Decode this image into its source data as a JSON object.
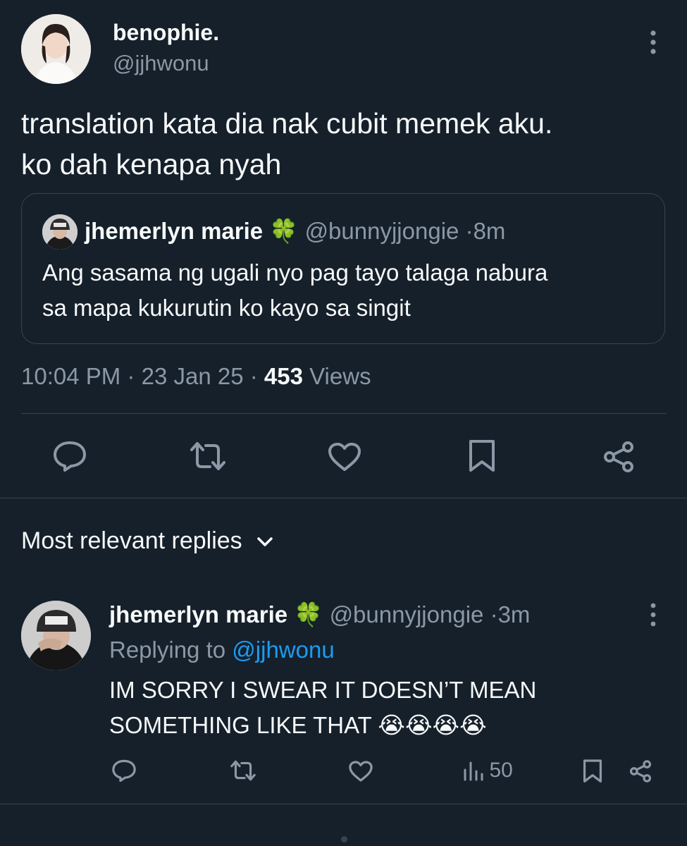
{
  "post": {
    "author_name": "benophie.",
    "author_handle": "@jjhwonu",
    "text_line1": "translation kata dia nak cubit memek aku.",
    "text_line2": "ko dah kenapa nyah",
    "quote": {
      "author_name": "jhemerlyn marie",
      "author_emoji": "🍀",
      "author_handle": "@bunnyjjongie",
      "sep": "·",
      "time": "8m",
      "text_line1": "Ang sasama ng ugali nyo pag tayo talaga nabura",
      "text_line2": "sa mapa kukurutin ko kayo sa singit"
    },
    "time": "10:04 PM",
    "sep1": "·",
    "date": "23 Jan 25",
    "sep2": "·",
    "views_count": "453",
    "views_label": "Views"
  },
  "replies_section": {
    "sort_label": "Most relevant replies"
  },
  "reply": {
    "author_name": "jhemerlyn marie",
    "author_emoji": "🍀",
    "author_handle": "@bunnyjjongie",
    "sep": "·",
    "time": "3m",
    "replying_to_label": "Replying to",
    "replying_to_handle": "@jjhwonu",
    "text_line1": "IM SORRY I SWEAR IT DOESN’T MEAN",
    "text_line2": "SOMETHING LIKE THAT",
    "emojis": "😭😭😭😭",
    "views": "50"
  },
  "colors": {
    "background": "#15202b",
    "text": "#f7f9f9",
    "muted": "#8b98a5",
    "link": "#1d9bf0",
    "border": "#38444d"
  }
}
